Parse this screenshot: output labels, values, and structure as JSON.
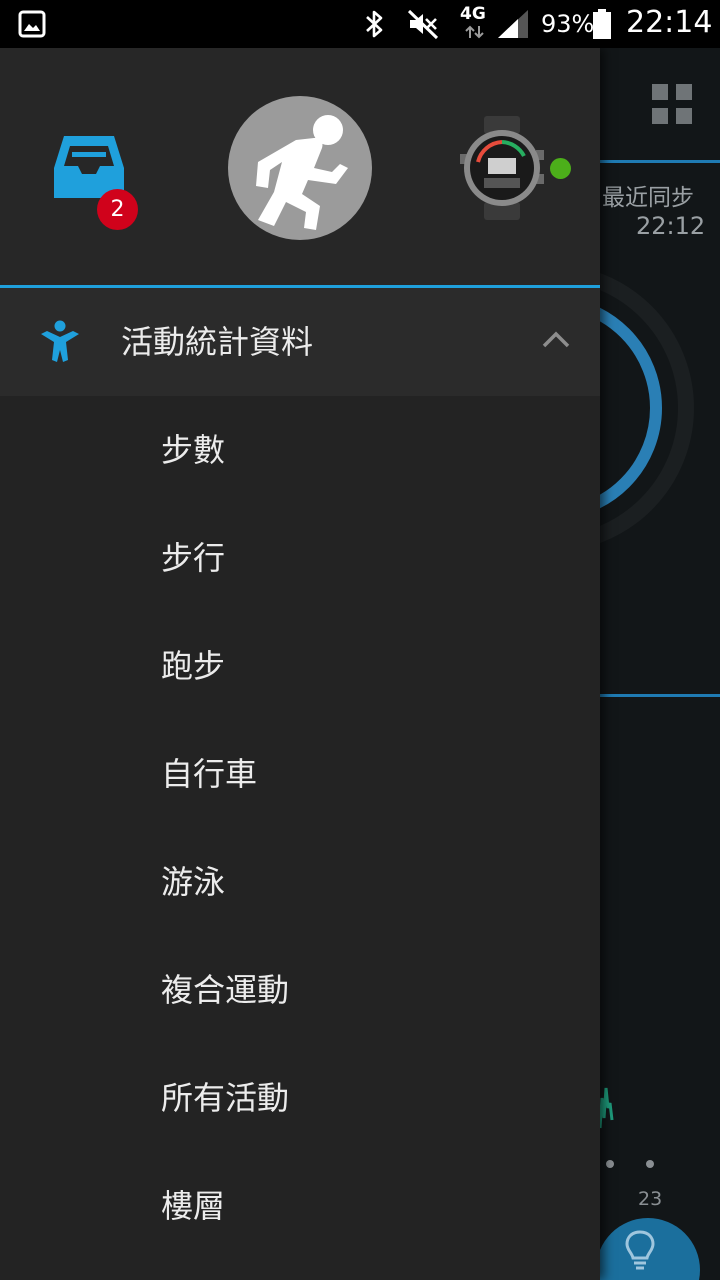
{
  "status_bar": {
    "network": "4G",
    "battery": "93%",
    "time": "22:14"
  },
  "background_app": {
    "sync_label": "最近同步",
    "sync_time": "22:12",
    "axis_label": "23"
  },
  "drawer": {
    "inbox_badge": "2",
    "section_title": "活動統計資料",
    "items": [
      {
        "label": "步數"
      },
      {
        "label": "步行"
      },
      {
        "label": "跑步"
      },
      {
        "label": "自行車"
      },
      {
        "label": "游泳"
      },
      {
        "label": "複合運動"
      },
      {
        "label": "所有活動"
      },
      {
        "label": "樓層"
      }
    ]
  },
  "colors": {
    "accent": "#1fa0dc",
    "drawer_bg": "#232323",
    "badge": "#d0021b",
    "connected": "#4caf1a"
  }
}
